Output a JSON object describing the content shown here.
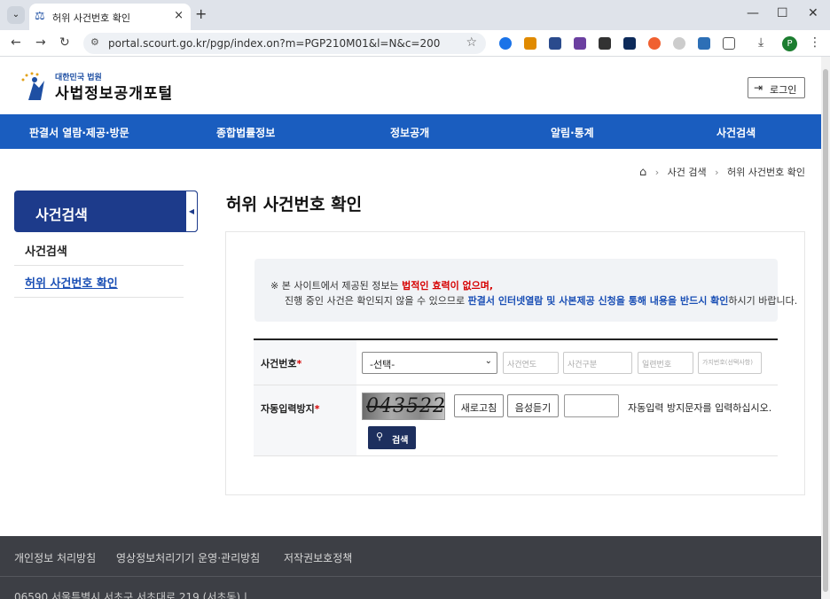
{
  "browser": {
    "tab_title": "허위 사건번호 확인",
    "url": "portal.scourt.go.kr/pgp/index.on?m=PGP210M01&l=N&c=200",
    "profile_initial": "P"
  },
  "header": {
    "logo_sub": "대한민국 법원",
    "logo_main": "사법정보공개포털",
    "login_label": "로그인"
  },
  "gnb": [
    "판결서 열람·제공·방문",
    "종합법률정보",
    "정보공개",
    "알림·통계",
    "사건검색"
  ],
  "breadcrumb": [
    "사건 검색",
    "허위 사건번호 확인"
  ],
  "sidebar": {
    "title": "사건검색",
    "items": [
      {
        "label": "사건검색"
      },
      {
        "label": "허위 사건번호 확인"
      }
    ]
  },
  "page_title": "허위 사건번호 확인",
  "notice": {
    "line1_prefix": "※ 본 사이트에서 제공된 정보는 ",
    "line1_red": "법적인 효력이 없으며",
    "line1_suffix": ",",
    "line2_prefix": "진행 중인 사건은 확인되지 않을 수 있으므로 ",
    "line2_blue": "판결서 인터넷열람 및 사본제공 신청을 통해 내용을 반드시 확인",
    "line2_suffix": "하시기 바랍니다."
  },
  "form": {
    "case_number_label": "사건번호",
    "select_value": "-선택-",
    "year_placeholder": "사건연도",
    "type_placeholder": "사건구분",
    "serial_placeholder": "일련번호",
    "branch_placeholder": "가지번호(선택사항)",
    "captcha_label": "자동입력방지",
    "captcha_text": "043522",
    "refresh_label": "새로고침",
    "audio_label": "음성듣기",
    "captcha_hint": "자동입력 방지문자를 입력하십시오.",
    "search_label": "검색"
  },
  "footer": {
    "links": [
      "개인정보 처리방침",
      "영상정보처리기기 운영·관리방침",
      "저작권보호정책"
    ],
    "address": "06590 서울특별시 서초구 서초대로 219 (서초동) |"
  }
}
